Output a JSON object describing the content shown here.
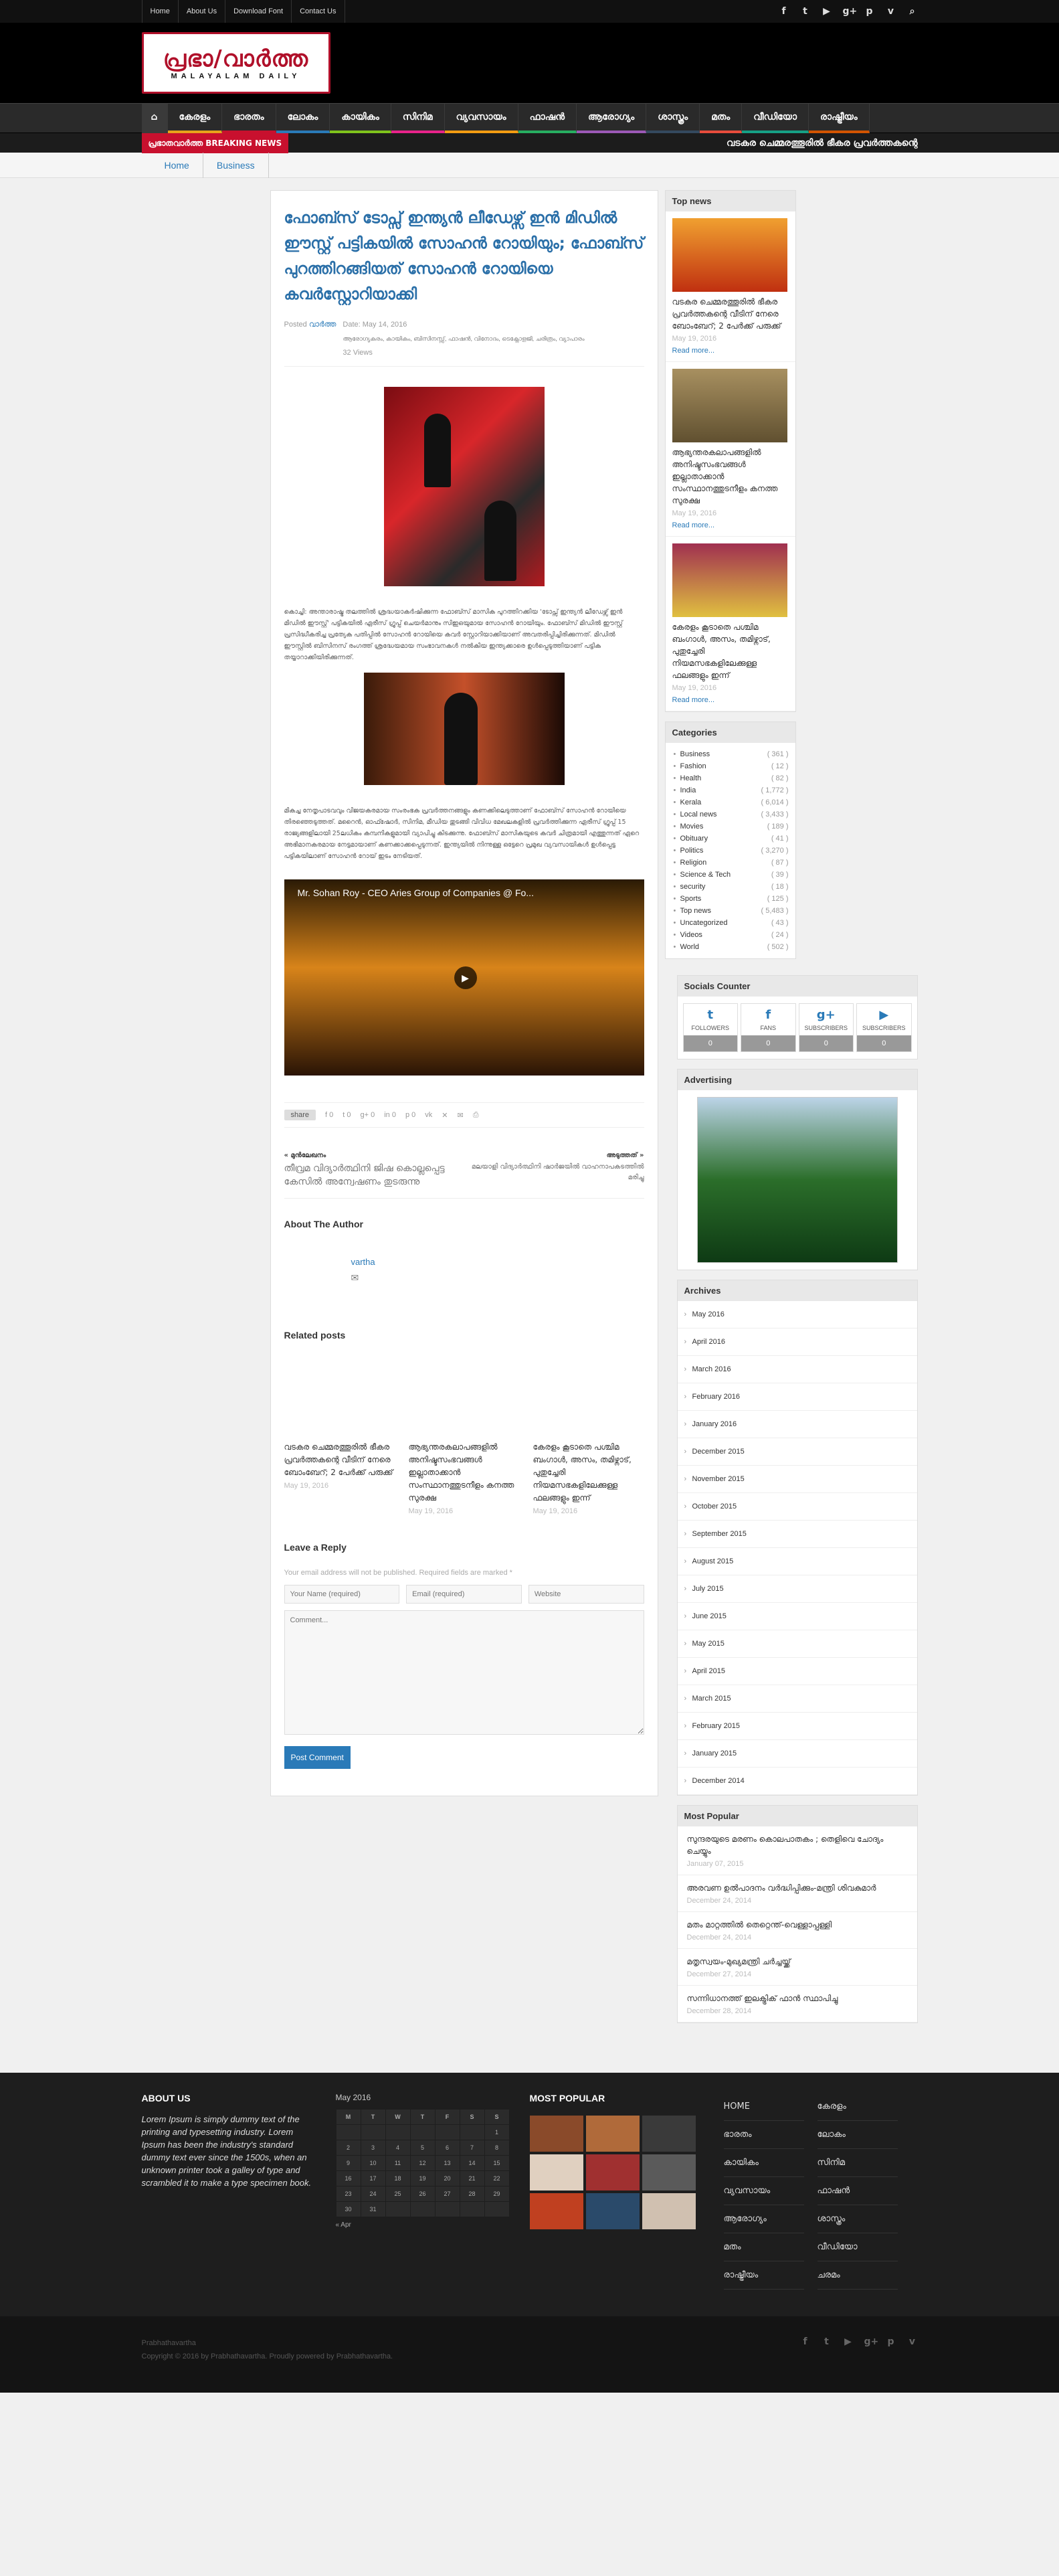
{
  "topnav": [
    "Home",
    "About Us",
    "Download Font",
    "Contact Us"
  ],
  "social_icons": [
    "facebook-icon",
    "twitter-icon",
    "youtube-icon",
    "googleplus-icon",
    "pinterest-icon",
    "vimeo-icon",
    "search-icon"
  ],
  "social_glyphs": [
    "f",
    "t",
    "▶",
    "g+",
    "p",
    "v",
    "⌕"
  ],
  "logo": {
    "main": "പ്രഭാ/വാർത്ത",
    "sub": "MALAYALAM DAILY"
  },
  "mainnav": [
    "കേരളം",
    "ഭാരതം",
    "ലോകം",
    "കായികം",
    "സിനിമ",
    "വ്യവസായം",
    "ഫാഷൻ",
    "ആരോഗ്യം",
    "ശാസ്ത്രം",
    "മതം",
    "വീഡിയോ",
    "രാഷ്ട്രീയം"
  ],
  "nav_colors": [
    "#e8a21b",
    "#c8102e",
    "#2a7ab8",
    "#7fc31c",
    "#e8238a",
    "#f39c12",
    "#27ae60",
    "#9b59b6",
    "#34495e",
    "#e74c3c",
    "#16a085",
    "#d35400"
  ],
  "breaking": {
    "label": "പ്രഭാതവാർത്ത BREAKING NEWS",
    "ticker": "വടകര ചെമ്മരത്തൂരിൽ ഭീകര പ്രവർത്തകന്റെ"
  },
  "breadcrumb": [
    "Home",
    "Business"
  ],
  "article": {
    "title": "ഫോബ്സ് ടോപ്സ് ഇന്ത്യൻ ലീഡേഴ്സ് ഇൻ മിഡിൽ ഈസ്റ്റ് പട്ടികയിൽ സോഹൻ റോയിയും; ഫോബ്സ് പുറത്തിറങ്ങിയത് സോഹൻ റോയിയെ കവർസ്റ്റോറിയാക്കി",
    "posted": "Posted",
    "author_short": "വാർത്ത",
    "date": "Date: May 14, 2016",
    "cats": "ആരോഗ്യകരം, കായികം, ബിസിനസ്സ്, ഫാഷൻ, വിനോദം, ടെക്നോളജി, ചരിത്രം, വ്യാപാരം",
    "views": "32 Views",
    "para1": "കൊച്ചി: അന്താരാഷ്ട്ര തലത്തിൽ ശ്രദ്ധയാകർഷിക്കുന്ന ഫോബ്സ് മാസിക പുറത്തിറക്കിയ 'ടോപ്സ് ഇന്ത്യൻ ലീഡേഴ്സ് ഇൻ മിഡിൽ ഈസ്റ്റ്' പട്ടികയിൽ ഏരീസ് ഗ്രൂപ്പ് ചെയർമാനും സിഇഒയുമായ സോഹൻ റോയിയും. ഫോബ്സ് മിഡിൽ ഈസ്റ്റ് പ്രസിദ്ധീകരിച്ച പ്രത്യേക പതിപ്പിൽ സോഹൻ റോയിയെ കവർ സ്റ്റോറിയാക്കിയാണ് അവതരിപ്പിച്ചിരിക്കുന്നത്. മിഡിൽ ഈസ്റ്റിൽ ബിസിനസ് രംഗത്ത് ശ്രദ്ധേയമായ സംഭാവനകൾ നൽകിയ ഇന്ത്യക്കാരെ ഉൾപ്പെടുത്തിയാണ് പട്ടിക തയ്യാറാക്കിയിരിക്കുന്നത്.",
    "para2": "മികച്ച നേതൃപാടവവും വിജയകരമായ സംരംഭക പ്രവർത്തനങ്ങളും കണക്കിലെടുത്താണ് ഫോബ്സ് സോഹൻ റോയിയെ തിരഞ്ഞെടുത്തത്. മറൈൻ, ഓഫ്ഷോർ, സിനിമ, മീഡിയ തുടങ്ങി വിവിധ മേഖലകളിൽ പ്രവർത്തിക്കുന്ന ഏരീസ് ഗ്രൂപ്പ് 15 രാജ്യങ്ങളിലായി 25ലധികം കമ്പനികളുമായി വ്യാപിച്ചു കിടക്കുന്നു. ഫോബ്സ് മാസികയുടെ കവർ ചിത്രമായി എത്തുന്നത് ഏറെ അഭിമാനകരമായ നേട്ടമായാണ് കണക്കാക്കപ്പെടുന്നത്. ഇന്ത്യയിൽ നിന്നുള്ള ഒട്ടേറെ പ്രമുഖ വ്യവസായികൾ ഉൾപ്പെട്ട പട്ടികയിലാണ് സോഹൻ റോയ് ഇടം നേടിയത്.",
    "video_title": "Mr. Sohan Roy - CEO Aries Group of Companies @ Fo...",
    "share_label": "share",
    "share_counts": [
      "f 0",
      "t 0",
      "g+ 0",
      "in 0",
      "p 0",
      "vk",
      "✕",
      "✉",
      "⎙"
    ],
    "prev_label": "മുൻലേഖനം",
    "prev_title": "തീവ്രമ വിദ്യാർത്ഥിനി ജിഷ കൊല്ലപ്പെട്ട കേസിൽ അന്വേഷണം തുടരുന്നു",
    "next_label": "അടുത്തത്",
    "next_title": "മലയാളി വിദ്യാർത്ഥിനി ഷാർജയിൽ വാഹനാപകടത്തിൽ മരിച്ചു",
    "about_author": "About The Author",
    "author_name": "vartha",
    "related_heading": "Related posts",
    "related": [
      {
        "t": "വടകര ചെമ്മരത്തൂരിൽ ഭീകര പ്രവർത്തകന്റെ വീടിന് നേരെ ബോംബേറ്; 2 പേർക്ക് പരുക്ക്",
        "d": "May 19, 2016"
      },
      {
        "t": "ആഭ്യന്തരകലാപങ്ങളിൽ അനിഷ്ടസംഭവങ്ങൾ ഇല്ലാതാക്കാൻ സംസ്ഥാനത്തുടനീളം കനത്ത സുരക്ഷ",
        "d": "May 19, 2016"
      },
      {
        "t": "കേരളം കൂടാതെ പശ്ചിമ ബംഗാൾ, അസം, തമിഴ്നാട്, പുതുച്ചേരി നിയമസഭകളിലേക്കുള്ള ഫലങ്ങളും ഇന്ന്",
        "d": "May 19, 2016"
      }
    ],
    "reply_heading": "Leave a Reply",
    "reply_note": "Your email address will not be published. Required fields are marked *",
    "ph_name": "Your Name (required)",
    "ph_email": "Email (required)",
    "ph_web": "Website",
    "ph_comment": "Comment...",
    "post_btn": "Post Comment"
  },
  "topnews": {
    "heading": "Top news",
    "items": [
      {
        "t": "വടകര ചെമ്മരത്തൂരിൽ ഭീകര പ്രവർത്തകന്റെ വീടിന് നേരെ ബോംബേറ്; 2 പേർക്ക് പരുക്ക്",
        "d": "May 19, 2016",
        "m": "Read more..."
      },
      {
        "t": "ആഭ്യന്തരകലാപങ്ങളിൽ അനിഷ്ടസംഭവങ്ങൾ ഇല്ലാതാക്കാൻ സംസ്ഥാനത്തുടനീളം കനത്ത സുരക്ഷ",
        "d": "May 19, 2016",
        "m": "Read more..."
      },
      {
        "t": "കേരളം കൂടാതെ പശ്ചിമ ബംഗാൾ, അസം, തമിഴ്നാട്, പുതുച്ചേരി നിയമസഭകളിലേക്കുള്ള ഫലങ്ങളും ഇന്ന്",
        "d": "May 19, 2016",
        "m": "Read more..."
      }
    ]
  },
  "categories": {
    "heading": "Categories",
    "items": [
      [
        "Business",
        "( 361 )"
      ],
      [
        "Fashion",
        "( 12 )"
      ],
      [
        "Health",
        "( 82 )"
      ],
      [
        "India",
        "( 1,772 )"
      ],
      [
        "Kerala",
        "( 6,014 )"
      ],
      [
        "Local news",
        "( 3,433 )"
      ],
      [
        "Movies",
        "( 189 )"
      ],
      [
        "Obituary",
        "( 41 )"
      ],
      [
        "Politics",
        "( 3,270 )"
      ],
      [
        "Religion",
        "( 87 )"
      ],
      [
        "Science & Tech",
        "( 39 )"
      ],
      [
        "security",
        "( 18 )"
      ],
      [
        "Sports",
        "( 125 )"
      ],
      [
        "Top news",
        "( 5,483 )"
      ],
      [
        "Uncategorized",
        "( 43 )"
      ],
      [
        "Videos",
        "( 24 )"
      ],
      [
        "World",
        "( 502 )"
      ]
    ]
  },
  "counter": {
    "heading": "Socials Counter",
    "items": [
      {
        "ic": "t",
        "lab": "FOLLOWERS",
        "n": "0"
      },
      {
        "ic": "f",
        "lab": "FANS",
        "n": "0"
      },
      {
        "ic": "g+",
        "lab": "SUBSCRIBERS",
        "n": "0"
      },
      {
        "ic": "▶",
        "lab": "SUBSCRIBERS",
        "n": "0"
      }
    ]
  },
  "advertising": "Advertising",
  "archives": {
    "heading": "Archives",
    "items": [
      "May 2016",
      "April 2016",
      "March 2016",
      "February 2016",
      "January 2016",
      "December 2015",
      "November 2015",
      "October 2015",
      "September 2015",
      "August 2015",
      "July 2015",
      "June 2015",
      "May 2015",
      "April 2015",
      "March 2015",
      "February 2015",
      "January 2015",
      "December 2014"
    ]
  },
  "popular": {
    "heading": "Most Popular",
    "items": [
      {
        "t": "സുന്ദരയുടെ മരണം കൊലപാതകം ; തെളിവെ ചോദ്യം ചെയ്യും",
        "d": "January 07, 2015"
      },
      {
        "t": "അരവണ ഉൽപാദനം വർദ്ധിപ്പിക്കും-മന്ത്രി ശിവകുമാർ",
        "d": "December 24, 2014"
      },
      {
        "t": "മതം മാറ്റത്തിൽ തെറ്റെന്ത്-വെള്ളാപ്പള്ളി",
        "d": "December 24, 2014"
      },
      {
        "t": "മതൃസ്വയം-മുഖ്യമന്ത്രി ചർച്ചയ്ക്ക്",
        "d": "December 27, 2014"
      },
      {
        "t": "സന്നിധാനത്ത് ഇലക്ട്രിക് ഫാൻ സ്ഥാപിച്ചു",
        "d": "December 28, 2014"
      }
    ]
  },
  "footer": {
    "about_heading": "ABOUT US",
    "about_text": "Lorem Ipsum is simply dummy text of the printing and typesetting industry. Lorem Ipsum has been the industry's standard dummy text ever since the 1500s, when an unknown printer took a galley of type and scrambled it to make a type specimen book.",
    "cal_month": "May 2016",
    "cal_head": [
      "M",
      "T",
      "W",
      "T",
      "F",
      "S",
      "S"
    ],
    "cal_rows": [
      [
        "",
        "",
        "",
        "",
        "",
        "",
        "1"
      ],
      [
        "2",
        "3",
        "4",
        "5",
        "6",
        "7",
        "8"
      ],
      [
        "9",
        "10",
        "11",
        "12",
        "13",
        "14",
        "15"
      ],
      [
        "16",
        "17",
        "18",
        "19",
        "20",
        "21",
        "22"
      ],
      [
        "23",
        "24",
        "25",
        "26",
        "27",
        "28",
        "29"
      ],
      [
        "30",
        "31",
        "",
        "",
        "",
        "",
        ""
      ]
    ],
    "cal_prev": "« Apr",
    "popular_heading": "MOST POPULAR",
    "links": [
      "HOME",
      "കേരളം",
      "ഭാരതം",
      "ലോകം",
      "കായികം",
      "സിനിമ",
      "വ്യവസായം",
      "ഫാഷൻ",
      "ആരോഗ്യം",
      "ശാസ്ത്രം",
      "മതം",
      "വീഡിയോ",
      "രാഷ്ട്രീയം",
      "ചരമം"
    ],
    "site": "Prabhathavartha",
    "copyright": "Copyright © 2016 by Prabhathavartha. Proudly powered by Prabhathavartha."
  },
  "colors": {
    "brand": "#b0102a",
    "link": "#2a7ab8",
    "breaking": "#c8102e"
  }
}
